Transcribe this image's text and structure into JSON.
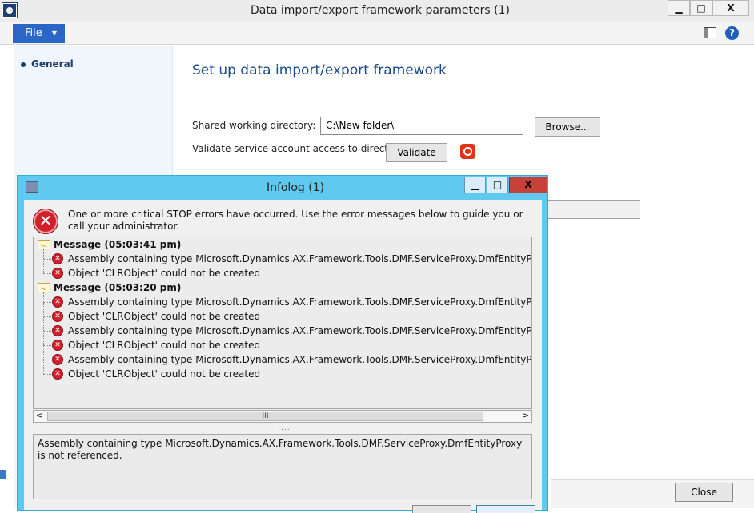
{
  "main_window": {
    "title": "Data import/export framework parameters (1)",
    "app_icon_glyph": "⚈",
    "controls": {
      "minimize": "▁",
      "maximize": "□",
      "close": "X"
    }
  },
  "menu": {
    "file_label": "File",
    "file_arrow": "▼",
    "help_glyph": "?"
  },
  "sidebar": {
    "items": [
      {
        "label": "General"
      }
    ]
  },
  "page": {
    "heading": "Set up data import/export framework",
    "shared_dir_label": "Shared working directory:",
    "shared_dir_value": "C:\\New folder\\",
    "browse_label": "Browse...",
    "validate_label": "Validate service account access to directory",
    "validate_button": "Validate",
    "close_button": "Close"
  },
  "infolog": {
    "title": "Infolog (1)",
    "controls": {
      "minimize": "▁",
      "maximize": "□",
      "close": "X"
    },
    "summary": "One or more critical STOP errors have occurred. Use the error messages below to guide you or call your administrator.",
    "groups": [
      {
        "header": "Message (05:03:41 pm)",
        "items": [
          "Assembly containing type Microsoft.Dynamics.AX.Framework.Tools.DMF.ServiceProxy.DmfEntityProxy is not r",
          "Object 'CLRObject' could not be created"
        ]
      },
      {
        "header": "Message (05:03:20 pm)",
        "items": [
          "Assembly containing type Microsoft.Dynamics.AX.Framework.Tools.DMF.ServiceProxy.DmfEntityProxy is not r",
          "Object 'CLRObject' could not be created",
          "Assembly containing type Microsoft.Dynamics.AX.Framework.Tools.DMF.ServiceProxy.DmfEntityProxy is not r",
          "Object 'CLRObject' could not be created",
          "Assembly containing type Microsoft.Dynamics.AX.Framework.Tools.DMF.ServiceProxy.DmfEntityProxy is not r",
          "Object 'CLRObject' could not be created"
        ]
      }
    ],
    "scrollbar": {
      "left": "<",
      "thumb": "III",
      "right": ">"
    },
    "splitter": "....",
    "detail": "Assembly containing type Microsoft.Dynamics.AX.Framework.Tools.DMF.ServiceProxy.DmfEntityProxy is not referenced.",
    "error_glyph": "✕"
  },
  "colors": {
    "accent": "#2b66c6",
    "dialog_frame": "#5fc9ef",
    "error": "#d1202b",
    "heading": "#1c4a8e"
  }
}
